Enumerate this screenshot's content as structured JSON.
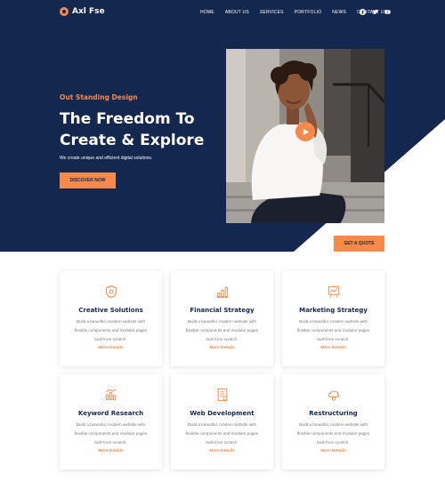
{
  "header": {
    "logo_text": "Axl Fse",
    "nav": [
      "Home",
      "About Us",
      "Services",
      "Portfolio",
      "News",
      "Contact Us"
    ],
    "social_icons": [
      "facebook-icon",
      "twitter-icon",
      "youtube-icon"
    ]
  },
  "hero": {
    "eyebrow": "Out Standing Design",
    "title_line1": "The Freedom To",
    "title_line2": "Create & Explore",
    "subtitle": "We create unique and efficient digital solutions.",
    "cta_label": "Discover Now",
    "quote_label": "Get A Quote"
  },
  "services": [
    {
      "title": "Creative Solutions",
      "desc": "Build a beautiful, modern website with flexible components and modular pages built from scratch.",
      "link": "More Details",
      "icon": "shield-icon"
    },
    {
      "title": "Financial Strategy",
      "desc": "Build a beautiful, modern website with flexible components and modular pages built from scratch.",
      "link": "More Details",
      "icon": "bar-chart-icon"
    },
    {
      "title": "Marketing Strategy",
      "desc": "Build a beautiful, modern website with flexible components and modular pages built from scratch.",
      "link": "More Details",
      "icon": "analytics-board-icon"
    },
    {
      "title": "Keyword Research",
      "desc": "Build a beautiful, modern website with flexible components and modular pages built from scratch.",
      "link": "More Details",
      "icon": "keyword-chart-icon"
    },
    {
      "title": "Web Development",
      "desc": "Build a beautiful, modern website with flexible components and modular pages built from scratch.",
      "link": "More Details",
      "icon": "document-code-icon"
    },
    {
      "title": "Restructuring",
      "desc": "Build a beautiful, modern website with flexible components and modular pages built from scratch.",
      "link": "More Details",
      "icon": "cloud-settings-icon"
    }
  ],
  "colors": {
    "navy": "#14274e",
    "accent": "#f58a4b"
  }
}
